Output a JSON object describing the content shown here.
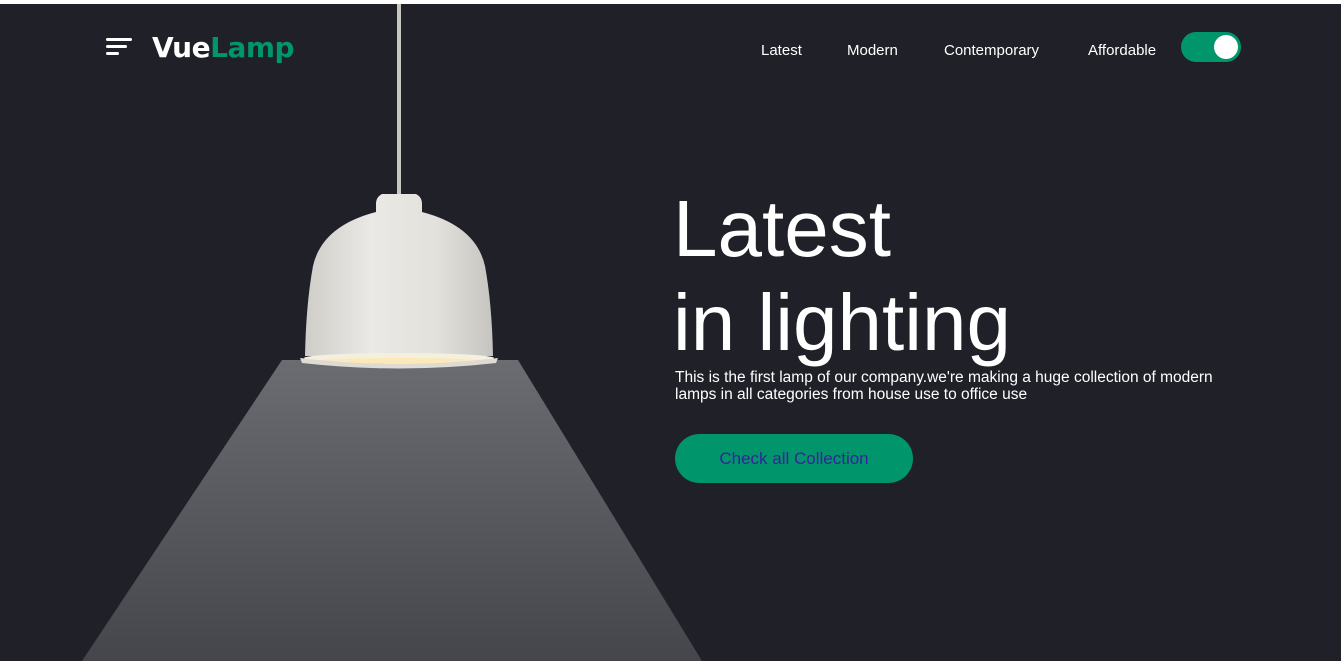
{
  "brand": {
    "name_part1": "Vue",
    "name_part2": "Lamp",
    "accent_color": "#00956b"
  },
  "header": {
    "menu_icon": "hamburger-menu-icon",
    "nav": [
      {
        "label": "Latest"
      },
      {
        "label": "Modern"
      },
      {
        "label": "Contemporary"
      },
      {
        "label": "Affordable"
      }
    ],
    "theme_toggle": {
      "state": "on"
    }
  },
  "hero": {
    "title_line1": "Latest",
    "title_line2": "in lighting",
    "description": "This is the first lamp of our company.we're making a huge collection of modern lamps in all categories from house use to office use",
    "cta_label": "Check all Collection"
  },
  "colors": {
    "background": "#1f2028",
    "text": "#ffffff",
    "cta_text": "#3a1f9e"
  }
}
